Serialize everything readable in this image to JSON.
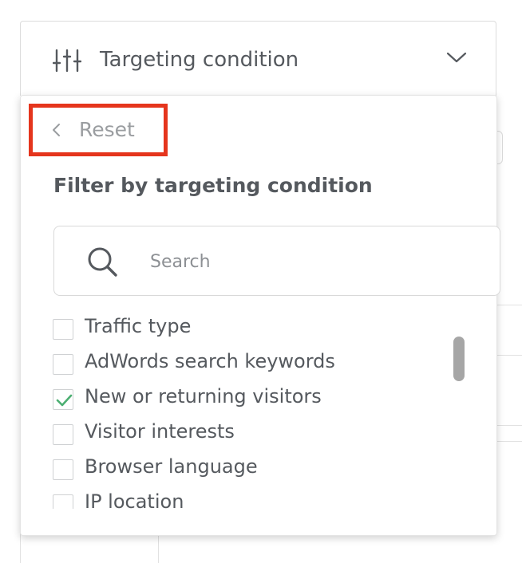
{
  "header": {
    "title": "Targeting condition",
    "filter_icon": "sliders-icon",
    "toggle_icon": "chevron-down-icon"
  },
  "panel": {
    "reset_label": "Reset",
    "reset_icon": "chevron-left-icon",
    "heading": "Filter by targeting condition",
    "search": {
      "placeholder": "Search",
      "value": "",
      "icon": "search-icon"
    },
    "items": [
      {
        "label": "Traffic type",
        "checked": false
      },
      {
        "label": "AdWords search keywords",
        "checked": false
      },
      {
        "label": "New or returning visitors",
        "checked": true
      },
      {
        "label": "Visitor interests",
        "checked": false
      },
      {
        "label": "Browser language",
        "checked": false
      },
      {
        "label": "IP location",
        "checked": false
      }
    ]
  },
  "colors": {
    "highlight": "#e5351d",
    "check": "#4caf72",
    "text": "#55595e",
    "muted": "#9a9da0"
  }
}
